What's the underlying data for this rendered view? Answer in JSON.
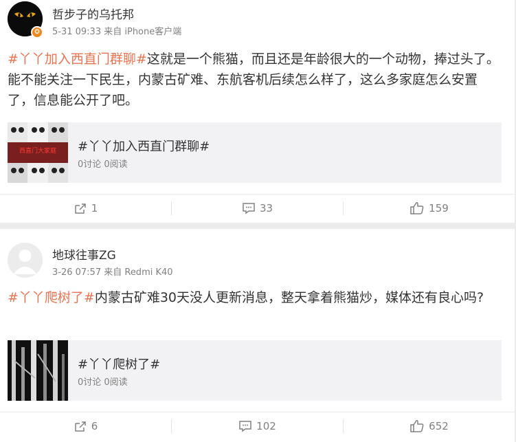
{
  "posts": [
    {
      "author": "哲步子的乌托邦",
      "meta": "5-31 09:33 来自 iPhone客户端",
      "tag": "#丫丫加入西直门群聊#",
      "body": "这就是一个熊猫，而且还是年龄很大的一个动物，捧过头了。能不能关注一下民生，内蒙古矿难、东航客机后续怎么样了，这么多家庭怎么安置了，信息能公开了吧。",
      "card": {
        "title": "#丫丫加入西直门群聊#",
        "stats": "0讨论 0阅读",
        "thumb_text": "西直门大家庭"
      },
      "actions": {
        "repost": "1",
        "comment": "33",
        "like": "159"
      }
    },
    {
      "author": "地球往事ZG",
      "meta": "3-26 07:57 来自 Redmi K40",
      "tag": "#丫丫爬树了#",
      "body": "内蒙古矿难30天没人更新消息，整天拿着熊猫炒，媒体还有良心吗?",
      "card": {
        "title": "#丫丫爬树了#",
        "stats": "0讨论 0阅读"
      },
      "actions": {
        "repost": "6",
        "comment": "102",
        "like": "652"
      }
    }
  ],
  "icons": {
    "repost": "share-box-icon",
    "comment": "comment-bubble-icon",
    "like": "thumbs-up-icon",
    "verified": "verified-badge-icon"
  },
  "colors": {
    "tag": "#eb7350",
    "muted": "#808080",
    "badge": "#f0861e"
  }
}
